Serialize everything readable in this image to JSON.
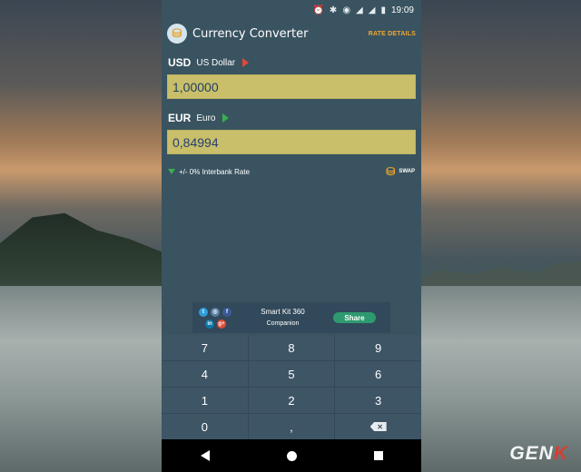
{
  "status_bar": {
    "time": "19:09",
    "icons": [
      "alarm-icon",
      "bluetooth-icon",
      "wifi-icon",
      "signal-icon",
      "signal-icon",
      "battery-icon"
    ]
  },
  "app": {
    "title": "Currency Converter",
    "rate_details": "RATE DETAILS"
  },
  "from": {
    "code": "USD",
    "name": "US Dollar",
    "amount": "1,00000",
    "indicator_color": "#e0483a"
  },
  "to": {
    "code": "EUR",
    "name": "Euro",
    "amount": "0,84994",
    "indicator_color": "#36b050"
  },
  "rate": {
    "text": "+/- 0% Interbank Rate",
    "swap_label": "SWAP"
  },
  "promo": {
    "line1": "Smart Kit 360",
    "line2": "Companion",
    "share_label": "Share",
    "social_icons": [
      "twitter-icon",
      "instagram-icon",
      "facebook-icon",
      "linkedin-icon",
      "google-plus-icon"
    ]
  },
  "keypad": {
    "keys": [
      "7",
      "8",
      "9",
      "4",
      "5",
      "6",
      "1",
      "2",
      "3",
      "0",
      ","
    ]
  },
  "nav_icons": [
    "back-icon",
    "home-icon",
    "recents-icon"
  ],
  "watermark": {
    "text_a": "GEN",
    "text_b": "K"
  },
  "colors": {
    "input_bg": "#c9bf6a",
    "app_bg": "#3a5360",
    "accent": "#f0a830",
    "share_btn": "#2e9a70"
  }
}
